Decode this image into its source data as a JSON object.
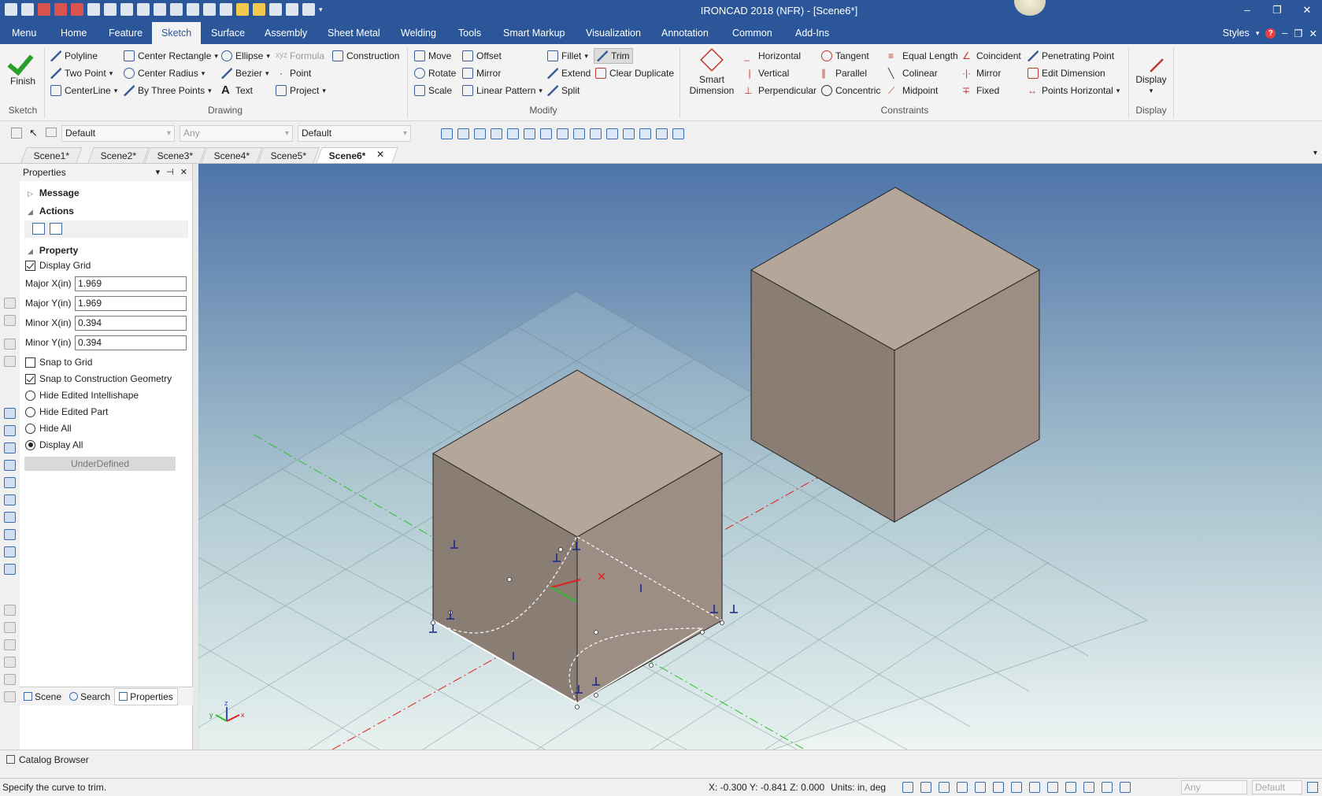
{
  "window": {
    "title": "IRONCAD 2018 (NFR) - [Scene6*]",
    "controls": [
      "–",
      "❐",
      "✕"
    ]
  },
  "menu": {
    "tabs": [
      "Menu",
      "Home",
      "Feature",
      "Sketch",
      "Surface",
      "Assembly",
      "Sheet Metal",
      "Welding",
      "Tools",
      "Smart Markup",
      "Visualization",
      "Annotation",
      "Common",
      "Add-Ins"
    ],
    "active": "Sketch",
    "styles_label": "Styles",
    "help": "?"
  },
  "ribbon": {
    "sketch": {
      "finish": "Finish",
      "group": "Sketch"
    },
    "drawing": {
      "group": "Drawing",
      "polyline": "Polyline",
      "two_point": "Two Point",
      "centerline": "CenterLine",
      "center_rectangle": "Center Rectangle",
      "center_radius": "Center Radius",
      "by_three_points": "By Three Points",
      "ellipse": "Ellipse",
      "bezier": "Bezier",
      "text": "Text",
      "formula": "Formula",
      "point": "Point",
      "project": "Project",
      "construction": "Construction"
    },
    "modify": {
      "group": "Modify",
      "move": "Move",
      "rotate": "Rotate",
      "scale": "Scale",
      "offset": "Offset",
      "mirror": "Mirror",
      "linear_pattern": "Linear Pattern",
      "fillet": "Fillet",
      "extend": "Extend",
      "split": "Split",
      "trim": "Trim",
      "clear_duplicate": "Clear Duplicate"
    },
    "constraints": {
      "group": "Constraints",
      "smart_dimension_1": "Smart",
      "smart_dimension_2": "Dimension",
      "horizontal": "Horizontal",
      "vertical": "Vertical",
      "perpendicular": "Perpendicular",
      "tangent": "Tangent",
      "parallel": "Parallel",
      "concentric": "Concentric",
      "equal_length": "Equal Length",
      "colinear": "Colinear",
      "midpoint": "Midpoint",
      "coincident": "Coincident",
      "mirror": "Mirror",
      "fixed": "Fixed",
      "penetrating_point": "Penetrating Point",
      "edit_dimension": "Edit Dimension",
      "points_horizontal": "Points Horizontal"
    },
    "display": {
      "label": "Display",
      "group": "Display"
    }
  },
  "toolbar2": {
    "combo1": "Default",
    "combo2": "Any",
    "combo3": "Default"
  },
  "scenes": {
    "tabs": [
      "Scene1*",
      "Scene2*",
      "Scene3*",
      "Scene4*",
      "Scene5*",
      "Scene6*"
    ],
    "active": "Scene6*",
    "close": "✕"
  },
  "properties": {
    "title": "Properties",
    "head_icons": [
      "▾",
      "⊣",
      "✕"
    ],
    "message": "Message",
    "actions": "Actions",
    "property": "Property",
    "display_grid": "Display Grid",
    "major_x_label": "Major X(in)",
    "major_x": "1.969",
    "major_y_label": "Major Y(in)",
    "major_y": "1.969",
    "minor_x_label": "Minor X(in)",
    "minor_x": "0.394",
    "minor_y_label": "Minor Y(in)",
    "minor_y": "0.394",
    "snap_to_grid": "Snap to Grid",
    "snap_to_construction": "Snap to Construction Geometry",
    "hide_edited_intellishape": "Hide Edited Intellishape",
    "hide_edited_part": "Hide Edited Part",
    "hide_all": "Hide All",
    "display_all": "Display All",
    "state": "UnderDefined",
    "bottom_tabs": {
      "scene": "Scene",
      "search": "Search",
      "properties": "Properties"
    }
  },
  "catalog": "Catalog Browser",
  "status": {
    "message": "Specify the curve to trim.",
    "coords": "X: -0.300 Y: -0.841 Z: 0.000",
    "units": "Units: in, deg",
    "combo1": "Any",
    "combo2": "Default"
  },
  "axes": {
    "x": "x",
    "y": "y",
    "z": "z"
  },
  "colors": {
    "brand": "#2b579a",
    "cube_top": "#b5a69a",
    "cube_left": "#8a7d73",
    "cube_right": "#9c8e84",
    "sky_top": "#4e74a8",
    "sky_bottom": "#eef5f3"
  }
}
